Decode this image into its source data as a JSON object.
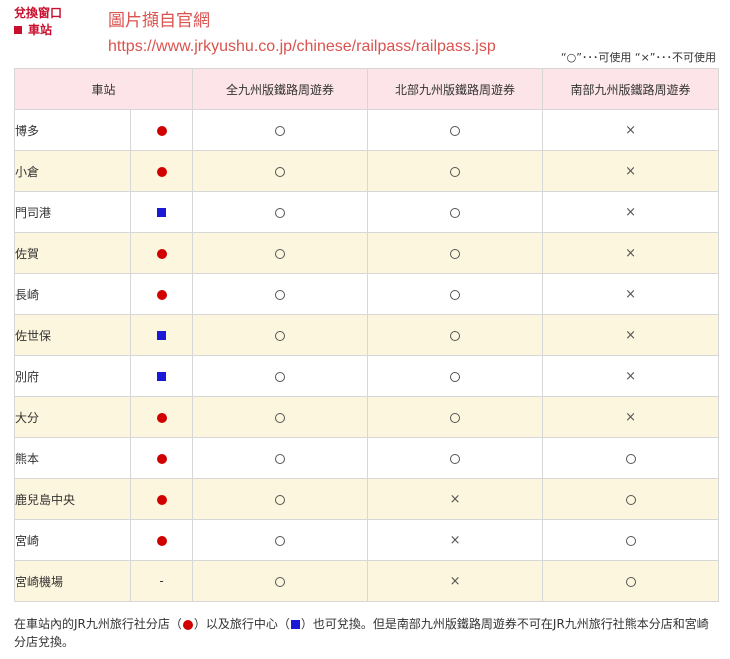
{
  "header": {
    "title": "兌換窗口",
    "subtitle": "車站"
  },
  "annotation": {
    "title": "圖片擷自官網",
    "url": "https://www.jrkyushu.co.jp/chinese/railpass/railpass.jsp"
  },
  "legend": {
    "text": "“○”･･･可使用 “×”･･･不可使用"
  },
  "table": {
    "headers": [
      "車站",
      "全九州版鐵路周遊券",
      "北部九州版鐵路周遊券",
      "南部九州版鐵路周遊券"
    ],
    "rows": [
      {
        "name": "博多",
        "mark": "dot",
        "all": "○",
        "north": "○",
        "south": "×"
      },
      {
        "name": "小倉",
        "mark": "dot",
        "all": "○",
        "north": "○",
        "south": "×"
      },
      {
        "name": "門司港",
        "mark": "square",
        "all": "○",
        "north": "○",
        "south": "×"
      },
      {
        "name": "佐賀",
        "mark": "dot",
        "all": "○",
        "north": "○",
        "south": "×"
      },
      {
        "name": "長崎",
        "mark": "dot",
        "all": "○",
        "north": "○",
        "south": "×"
      },
      {
        "name": "佐世保",
        "mark": "square",
        "all": "○",
        "north": "○",
        "south": "×"
      },
      {
        "name": "別府",
        "mark": "square",
        "all": "○",
        "north": "○",
        "south": "×"
      },
      {
        "name": "大分",
        "mark": "dot",
        "all": "○",
        "north": "○",
        "south": "×"
      },
      {
        "name": "熊本",
        "mark": "dot",
        "all": "○",
        "north": "○",
        "south": "○"
      },
      {
        "name": "鹿兒島中央",
        "mark": "dot",
        "all": "○",
        "north": "×",
        "south": "○"
      },
      {
        "name": "宮崎",
        "mark": "dot",
        "all": "○",
        "north": "×",
        "south": "○"
      },
      {
        "name": "宮崎機場",
        "mark": "-",
        "all": "○",
        "north": "×",
        "south": "○"
      }
    ]
  },
  "footnote": {
    "part1": "在車站內的JR九州旅行社分店（",
    "part2": "）以及旅行中心（",
    "part3": "）也可兌換。但是南部九州版鐵路周遊券不可在JR九州旅行社熊本分店和宮崎分店兌換。"
  },
  "colors": {
    "brand_red": "#c8102e",
    "annotation_red": "#d9534f",
    "dot_red": "#d00000",
    "square_blue": "#1a1ad6",
    "header_bg": "#fce4e8",
    "stripe_bg": "#fdf6de"
  }
}
